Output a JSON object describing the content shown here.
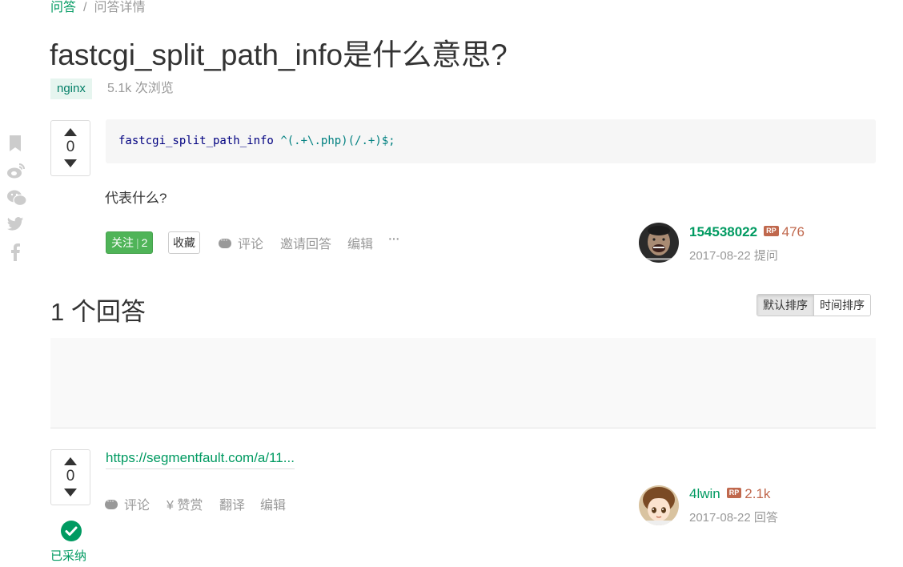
{
  "breadcrumb": {
    "root": "问答",
    "separator": "/",
    "current": "问答详情"
  },
  "question": {
    "title": "fastcgi_split_path_info是什么意思?",
    "tag": "nginx",
    "views": "5.1k 次浏览",
    "votes": "0",
    "code": {
      "directive": "fastcgi_split_path_info",
      "regex": "^(.+\\.php)(/.+)$;"
    },
    "text": "代表什么?",
    "follow_label": "关注",
    "follow_count": "2",
    "collect_label": "收藏",
    "comment_label": "评论",
    "invite_label": "邀请回答",
    "edit_label": "编辑",
    "more_label": "···",
    "author": {
      "name": "154538022",
      "rp_badge": "RP",
      "reputation": "476",
      "date": "2017-08-22 提问"
    }
  },
  "social_icons": [
    "bookmark-icon",
    "weibo-icon",
    "wechat-icon",
    "twitter-icon",
    "facebook-icon"
  ],
  "answers_header": {
    "title": "1 个回答",
    "sort_default": "默认排序",
    "sort_time": "时间排序"
  },
  "answer": {
    "votes": "0",
    "link": "https://segmentfault.com/a/11...",
    "comment_label": "评论",
    "reward_label": "¥ 赞赏",
    "translate_label": "翻译",
    "edit_label": "编辑",
    "accepted_label": "已采纳",
    "author": {
      "name": "4lwin",
      "rp_badge": "RP",
      "reputation": "2.1k",
      "date": "2017-08-22 回答"
    }
  },
  "colors": {
    "brand": "#009a61",
    "follow_button": "#4fb458",
    "reputation": "#c0684d",
    "muted": "#999999"
  }
}
